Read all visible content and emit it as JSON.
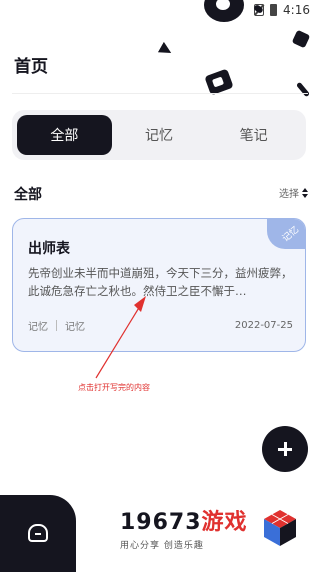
{
  "status_bar": {
    "time": "4:16",
    "icons": [
      "sim-off-icon",
      "battery-icon"
    ]
  },
  "header": {
    "title": "首页"
  },
  "tabs": [
    {
      "label": "全部",
      "active": true
    },
    {
      "label": "记忆",
      "active": false
    },
    {
      "label": "笔记",
      "active": false
    }
  ],
  "section": {
    "title": "全部",
    "sort_label": "选择"
  },
  "note_card": {
    "ribbon": "记忆",
    "title": "出师表",
    "body": "先帝创业未半而中道崩殂，今天下三分，益州疲弊，此诚危急存亡之秋也。然侍卫之臣不懈于…",
    "tags": [
      "记忆",
      "记忆"
    ],
    "date": "2022-07-25"
  },
  "annotation": {
    "text": "点击打开写完的内容"
  },
  "fab": {
    "icon": "plus-icon"
  },
  "bottom_nav": {
    "icon": "home-icon"
  },
  "watermark": {
    "number": "19673",
    "brand": "游戏",
    "tagline": "用心分享 创造乐趣"
  },
  "colors": {
    "accent": "#15151f",
    "card_border": "#9fb6e8",
    "card_bg": "#f1f4fc",
    "annotation": "#e0312f"
  }
}
